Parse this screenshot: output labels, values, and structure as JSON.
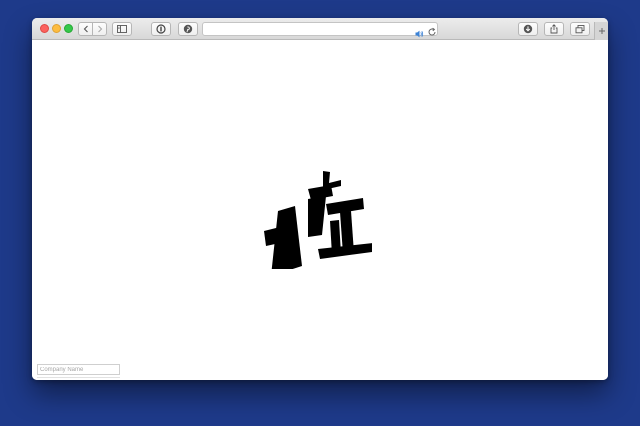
{
  "browser": {
    "address_value": "",
    "new_tab_symbol": "+"
  },
  "page": {
    "logo_glyph": "症",
    "form": {
      "company_placeholder": "Company Name",
      "company_value": ""
    }
  },
  "colors": {
    "desktop_background": "#1e3a8a",
    "page_background": "#ffffff",
    "logo": "#000000",
    "volume_icon": "#3b82d6"
  },
  "icons": [
    "back-arrow",
    "forward-arrow",
    "sidebar",
    "1password",
    "pinterest",
    "speaker",
    "reload",
    "download",
    "share",
    "tabs-overview"
  ]
}
